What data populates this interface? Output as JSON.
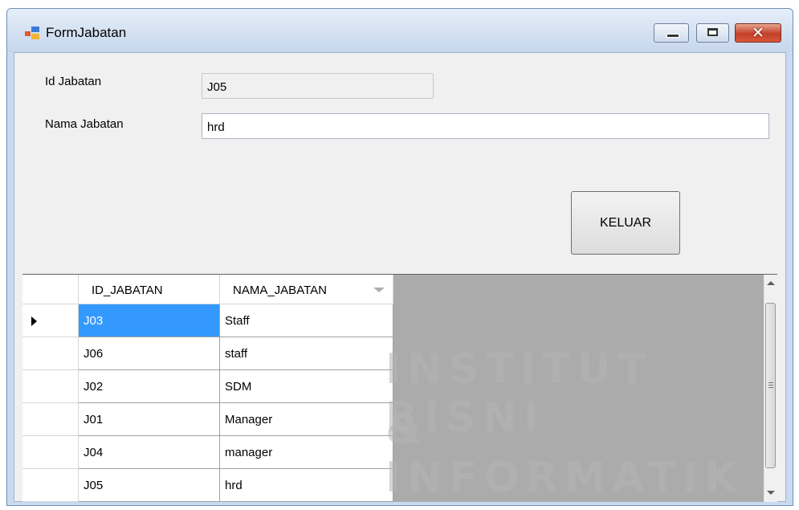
{
  "window": {
    "title": "FormJabatan",
    "close_glyph": "✕"
  },
  "form": {
    "id_label": "Id Jabatan",
    "id_value": "J05",
    "nama_label": "Nama Jabatan",
    "nama_value": "hrd",
    "keluar_label": "KELUAR"
  },
  "grid": {
    "columns": [
      "ID_JABATAN",
      "NAMA_JABATAN"
    ],
    "rows": [
      {
        "id": "J03",
        "nama": "Staff"
      },
      {
        "id": "J06",
        "nama": "staff"
      },
      {
        "id": "J02",
        "nama": "SDM"
      },
      {
        "id": "J01",
        "nama": "Manager"
      },
      {
        "id": "J04",
        "nama": "manager"
      },
      {
        "id": "J05",
        "nama": "hrd"
      }
    ]
  },
  "watermark": {
    "line1": "INSTITUT BISNI",
    "line2": "& INFORMATIK"
  },
  "colors": {
    "selection": "#3399ff",
    "close_button": "#c3402a"
  }
}
